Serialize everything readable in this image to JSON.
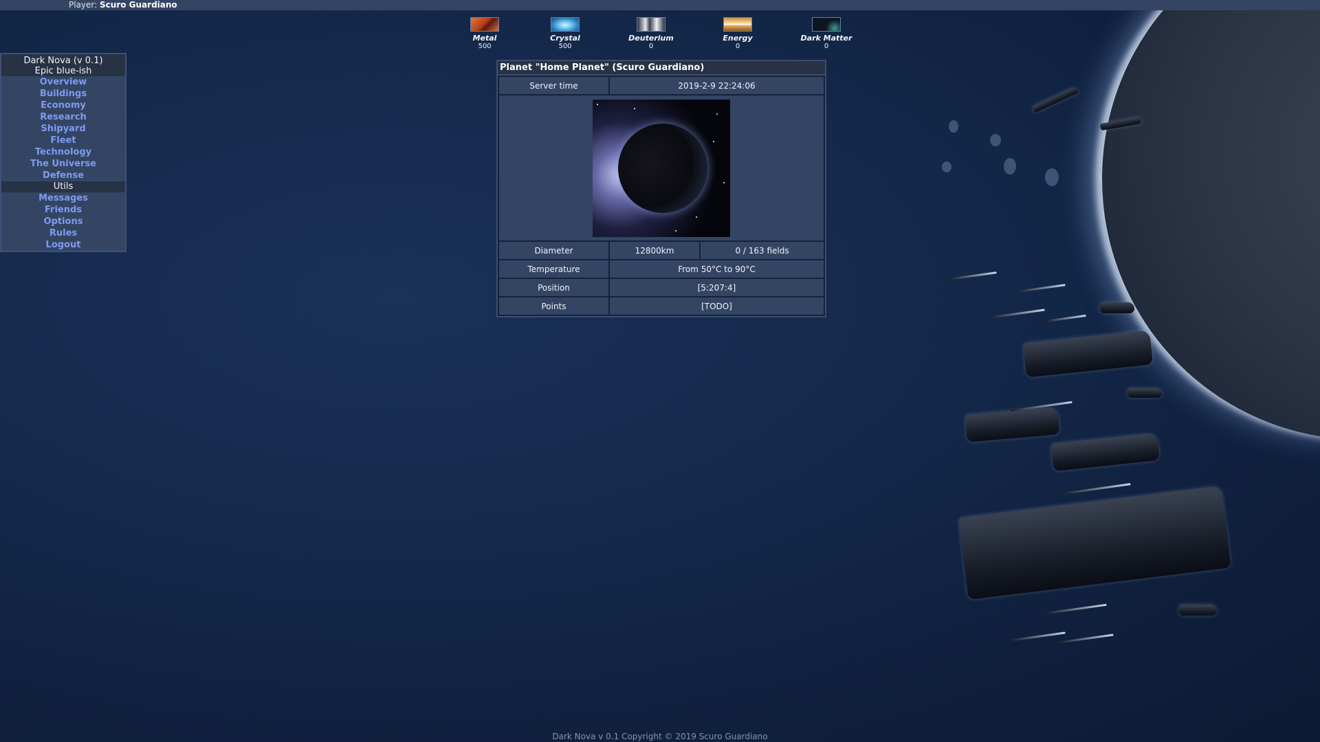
{
  "topbar": {
    "player_label": "Player:",
    "player_name": "Scuro Guardiano"
  },
  "resources": [
    {
      "name": "Metal",
      "value": "500",
      "icon": "metal-icon"
    },
    {
      "name": "Crystal",
      "value": "500",
      "icon": "crystal-icon"
    },
    {
      "name": "Deuterium",
      "value": "0",
      "icon": "deuterium-icon"
    },
    {
      "name": "Energy",
      "value": "0",
      "icon": "energy-icon"
    },
    {
      "name": "Dark Matter",
      "value": "0",
      "icon": "dark-matter-icon"
    }
  ],
  "menu": {
    "title": "Dark Nova (v 0.1)",
    "subtitle": "Epic blue-ish",
    "items": [
      "Overview",
      "Buildings",
      "Economy",
      "Research",
      "Shipyard",
      "Fleet",
      "Technology",
      "The Universe",
      "Defense"
    ],
    "section": "Utils",
    "utils_items": [
      "Messages",
      "Friends",
      "Options",
      "Rules",
      "Logout"
    ]
  },
  "planet": {
    "title": "Planet \"Home Planet\" (Scuro Guardiano)",
    "server_time_label": "Server time",
    "server_time": "2019-2-9 22:24:06",
    "diameter_label": "Diameter",
    "diameter": "12800km",
    "fields": "0 / 163 fields",
    "temperature_label": "Temperature",
    "temperature": "From 50°C to 90°C",
    "position_label": "Position",
    "position": "[5:207:4]",
    "points_label": "Points",
    "points": "[TODO]"
  },
  "footer": {
    "text": "Dark Nova v 0.1 Copyright © 2019 Scuro Guardiano"
  },
  "colors": {
    "bar": "#344564",
    "link": "#7e9bf0",
    "panel_dark": "#273244"
  }
}
